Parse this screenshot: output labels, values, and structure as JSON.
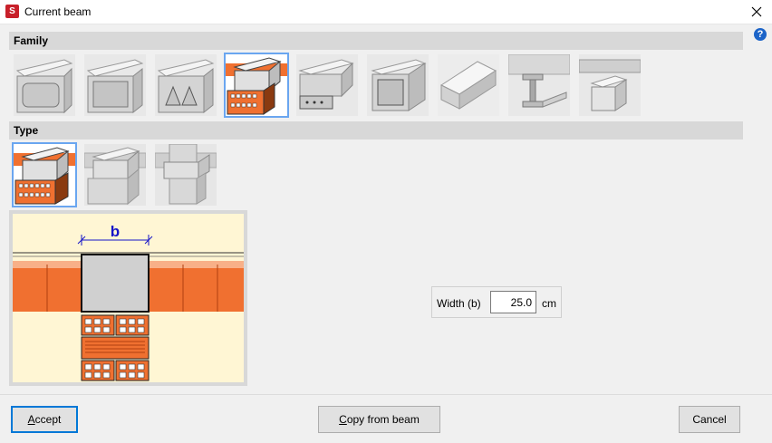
{
  "window": {
    "title": "Current beam",
    "close_glyph": "✕",
    "help_glyph": "?"
  },
  "app_icon_glyph": "S",
  "sections": {
    "family": "Family",
    "type": "Type"
  },
  "family_items": [
    {
      "icon": "hollow-core-slab-beam-icon"
    },
    {
      "icon": "box-beam-icon"
    },
    {
      "icon": "triangular-void-beam-icon"
    },
    {
      "icon": "brick-supported-beam-icon",
      "selected": true
    },
    {
      "icon": "beam-with-ledge-icon"
    },
    {
      "icon": "hollow-box-girder-icon"
    },
    {
      "icon": "solid-slab-icon"
    },
    {
      "icon": "steel-i-beam-icon"
    },
    {
      "icon": "concrete-block-beam-icon"
    }
  ],
  "type_items": [
    {
      "icon": "beam-on-brick-wall-icon",
      "selected": true
    },
    {
      "icon": "beam-on-masonry-icon"
    },
    {
      "icon": "beam-on-pillar-icon"
    }
  ],
  "preview": {
    "dimension_label": "b"
  },
  "width": {
    "label": "Width (b)",
    "value": "25.0",
    "unit": "cm"
  },
  "buttons": {
    "accept_underlined": "A",
    "accept_rest": "ccept",
    "copy_underlined": "C",
    "copy_rest": "opy from beam",
    "cancel": "Cancel"
  },
  "colors": {
    "selection_border": "#6aa6f0",
    "selection_fill": "#cfe3fb",
    "brick": "#f07030",
    "help": "#1c64c8",
    "dimension": "#1414c8"
  }
}
